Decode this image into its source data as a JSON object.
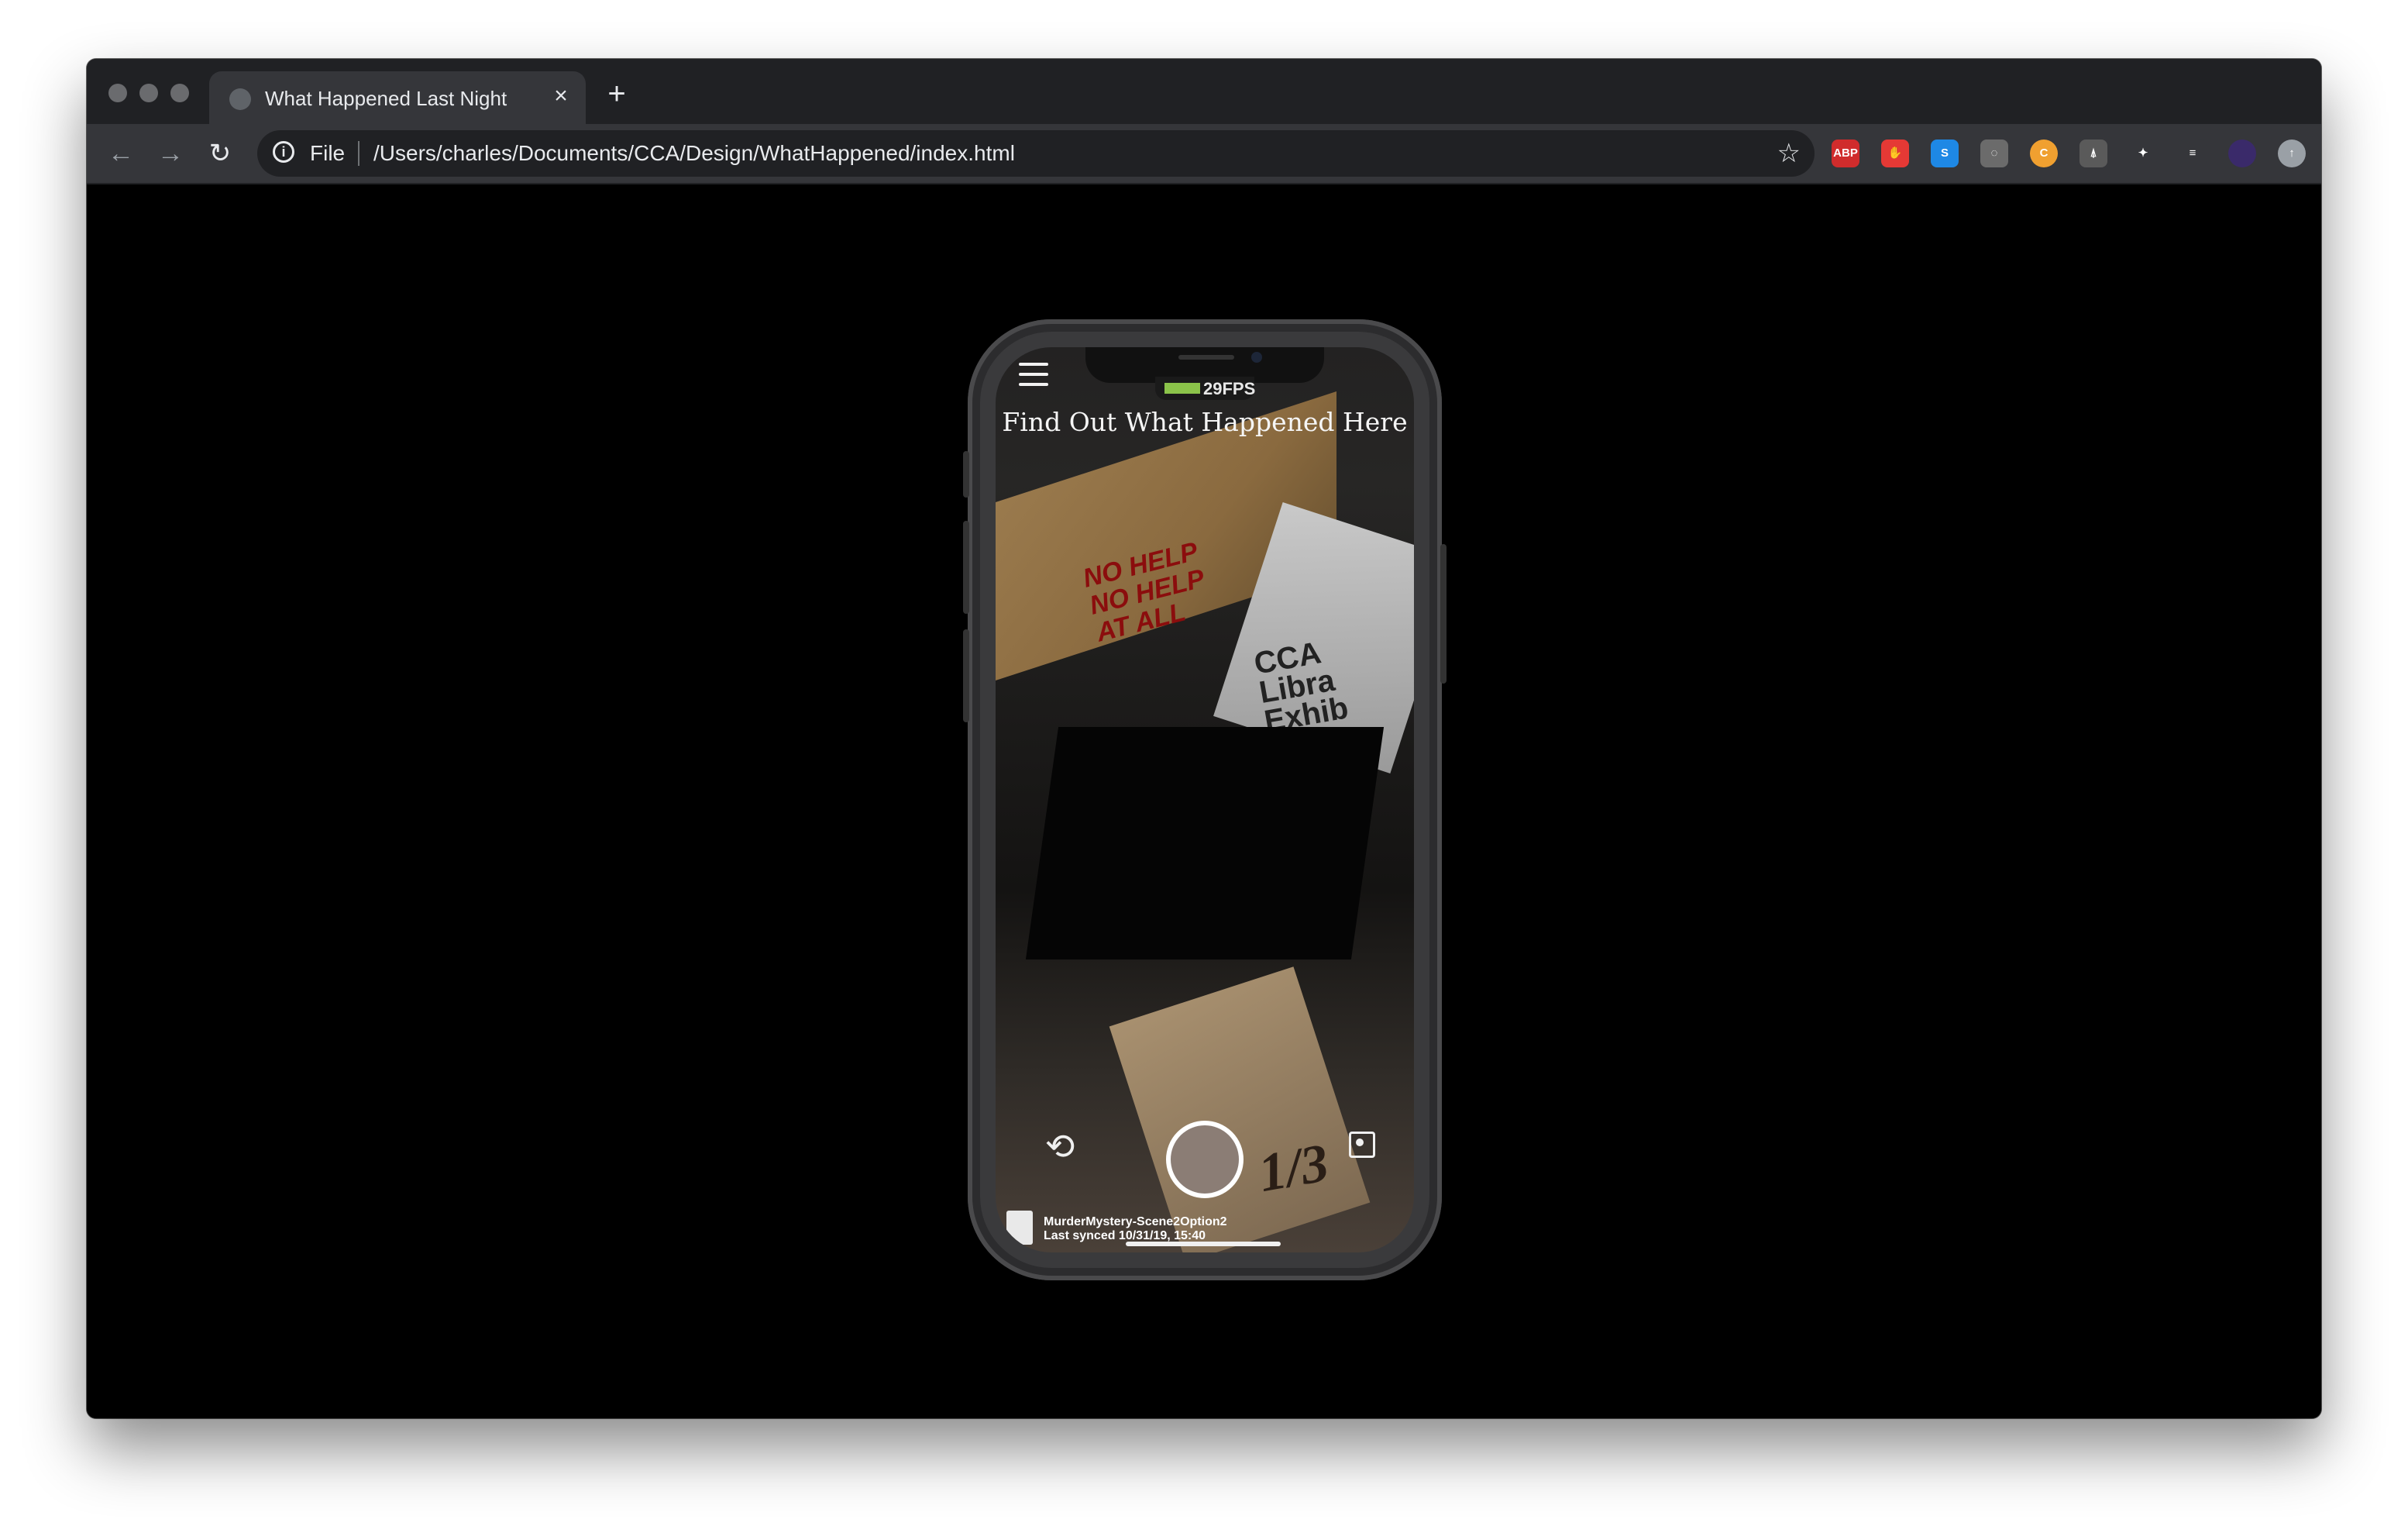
{
  "browser": {
    "tab_title": "What Happened Last Night",
    "new_tab_label": "+",
    "close_label": "×",
    "scheme_label": "File",
    "url": "/Users/charles/Documents/CCA/Design/WhatHappened/index.html",
    "extensions": [
      {
        "name": "adblock-icon",
        "label": "ABP",
        "color": "#d02c2c"
      },
      {
        "name": "stop-hand-icon",
        "label": "✋",
        "color": "#e53935"
      },
      {
        "name": "s-extension-icon",
        "label": "S",
        "color": "#1e88e5"
      },
      {
        "name": "eye-off-icon",
        "label": "◌",
        "color": "#6b6b6b"
      },
      {
        "name": "coupon-icon",
        "label": "C",
        "color": "#f0a030"
      },
      {
        "name": "mouse-icon",
        "label": "⍋",
        "color": "#5a5a5a"
      },
      {
        "name": "puzzle-icon",
        "label": "✦",
        "color": "#35363a"
      },
      {
        "name": "playlist-icon",
        "label": "≡",
        "color": "#35363a"
      },
      {
        "name": "profile-avatar-icon",
        "label": "",
        "color": "#3a2a6a"
      },
      {
        "name": "update-icon",
        "label": "↑",
        "color": "#9aa0a6"
      }
    ]
  },
  "app": {
    "fps": "29FPS",
    "heading": "Find Out What Happened Here",
    "scene_writing": "NO HELP\nNO HELP\nAT ALL",
    "poster_text": "CCA\nLibra\nExhib",
    "card_text": "1/3",
    "sync_file_name": "MurderMystery-Scene2Option2",
    "sync_time": "Last synced 10/31/19, 15:40"
  }
}
